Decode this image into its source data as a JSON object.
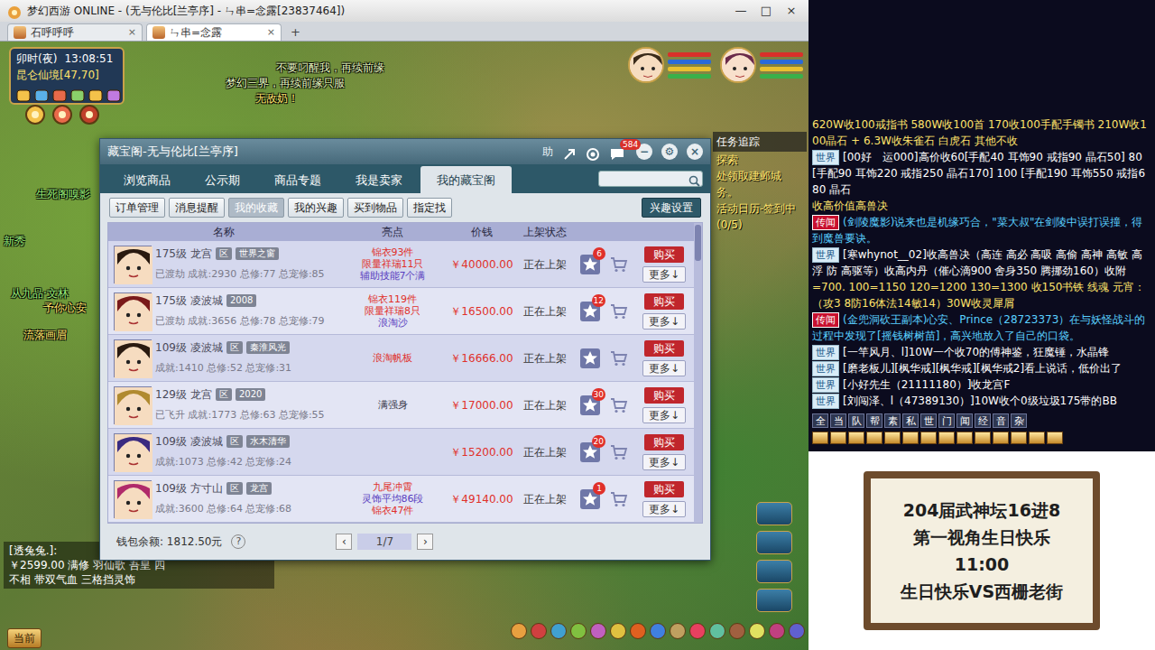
{
  "browser": {
    "title": "梦幻西游 ONLINE - (无与伦比[兰亭序] - ㄣ串=念露[23837464])",
    "controls": [
      "—",
      "□",
      "×"
    ],
    "tabs": [
      {
        "label": "石呼呼呼",
        "selected": false,
        "close": "×"
      },
      {
        "label": "ㄣ串=念露",
        "selected": true,
        "close": "×"
      }
    ],
    "new_tab": "+"
  },
  "hud": {
    "time": "卯时(夜)",
    "clock": "13:08:51",
    "location": "昆仑仙境[47,70]"
  },
  "scene_texts": [
    "不要叼醒我，再续前缘",
    "梦幻三界，再续前缘只服",
    "无敌奶！",
    "生死阁嗅影",
    "新秀",
    "从九品·文林",
    "予你心安",
    "流落画眉"
  ],
  "task": {
    "title": "任务追踪",
    "lines": [
      "探索",
      "处领取建邺城",
      "务。",
      "活动日历-签到中",
      "(0/5)"
    ]
  },
  "scene_chat": {
    "speaker": "[透兔兔.]:",
    "lines": [
      "￥2599.00  满修  羽仙歌  吾皇  四",
      "不相  带双气血  三格挡灵饰"
    ]
  },
  "bottom_button": "当前",
  "cbg": {
    "title": "藏宝阁-无与伦比[兰亭序]",
    "help": "助",
    "message_count": "584",
    "controls": [
      "−",
      "⚙",
      "×"
    ],
    "nav": [
      {
        "label": "浏览商品",
        "selected": false
      },
      {
        "label": "公示期",
        "selected": false
      },
      {
        "label": "商品专题",
        "selected": false
      },
      {
        "label": "我是卖家",
        "selected": false
      },
      {
        "label": "我的藏宝阁",
        "selected": true
      }
    ],
    "subnav": [
      {
        "label": "订单管理",
        "selected": false
      },
      {
        "label": "消息提醒",
        "selected": false
      },
      {
        "label": "我的收藏",
        "selected": true
      },
      {
        "label": "我的兴趣",
        "selected": false
      },
      {
        "label": "买到物品",
        "selected": false
      },
      {
        "label": "指定找",
        "selected": false
      }
    ],
    "interest_button": "兴趣设置",
    "columns": [
      "名称",
      "亮点",
      "价钱",
      "上架状态"
    ],
    "rows": [
      {
        "level": "175级",
        "school": "龙宫",
        "tags": [
          "区",
          "世界之窗"
        ],
        "info": "已渡劫 成就:2930 总修:77 总宠修:85",
        "highlights": [
          {
            "text": "锦衣93件",
            "color": "#e0302a"
          },
          {
            "text": "限量祥瑞11只",
            "color": "#e0302a"
          },
          {
            "text": "辅助技能7个满",
            "color": "#5a3fc0"
          }
        ],
        "price": "￥40000.00",
        "status": "正在上架",
        "favorites": "6",
        "buy": "购买",
        "more": "更多↓"
      },
      {
        "level": "175级",
        "school": "凌波城",
        "tags": [
          "2008"
        ],
        "info": "已渡劫 成就:3656 总修:78 总宠修:79",
        "highlights": [
          {
            "text": "锦衣119件",
            "color": "#e0302a"
          },
          {
            "text": "限量祥瑞8只",
            "color": "#e0302a"
          },
          {
            "text": "浪淘沙",
            "color": "#5a3fc0"
          }
        ],
        "price": "￥16500.00",
        "status": "正在上架",
        "favorites": "12",
        "buy": "购买",
        "more": "更多↓"
      },
      {
        "level": "109级",
        "school": "凌波城",
        "tags": [
          "区",
          "秦淮风光"
        ],
        "info": "成就:1410 总修:52 总宠修:31",
        "highlights": [
          {
            "text": "浪淘帆板",
            "color": "#e0302a"
          }
        ],
        "price": "￥16666.00",
        "status": "正在上架",
        "buy": "购买",
        "more": "更多↓"
      },
      {
        "level": "129级",
        "school": "龙宫",
        "tags": [
          "区",
          "2020"
        ],
        "info": "已飞升 成就:1773 总修:63 总宠修:55",
        "highlights": [
          {
            "text": "满强身",
            "color": "#333344"
          }
        ],
        "price": "￥17000.00",
        "status": "正在上架",
        "favorites": "30",
        "buy": "购买",
        "more": "更多↓"
      },
      {
        "level": "109级",
        "school": "凌波城",
        "tags": [
          "区",
          "水木清华"
        ],
        "info": "成就:1073 总修:42 总宠修:24",
        "highlights": [],
        "price": "￥15200.00",
        "status": "正在上架",
        "favorites": "20",
        "buy": "购买",
        "more": "更多↓"
      },
      {
        "level": "109级",
        "school": "方寸山",
        "tags": [
          "区",
          "龙宫"
        ],
        "info": "成就:3600 总修:64 总宠修:68",
        "highlights": [
          {
            "text": "九尾冲霄",
            "color": "#e0302a"
          },
          {
            "text": "灵饰平均86段",
            "color": "#5a3fc0"
          },
          {
            "text": "锦衣47件",
            "color": "#e0302a"
          }
        ],
        "price": "￥49140.00",
        "status": "正在上架",
        "favorites": "1",
        "buy": "购买",
        "more": "更多↓"
      }
    ],
    "wallet": "钱包余额: 1812.50元",
    "help_q": "?",
    "prev": "‹",
    "page": "1/7",
    "next": "›"
  },
  "chat": {
    "lines": [
      {
        "kind": "plain",
        "channel": "",
        "text": "620W收100戒指书 580W收100首 170收100手配手镯书 210W收100晶石 + 6.3W收朱雀石 白虎石 其他不收"
      },
      {
        "kind": "world",
        "channel": "世界",
        "text": "[00好ゞ运000]高价收60[手配40 耳饰90 戒指90 晶石50]  80[手配90 耳饰220 戒指250 晶石170]  100 [手配190 耳饰550 戒指680 晶石"
      },
      {
        "kind": "plain",
        "channel": "",
        "text": "收高价值高兽决"
      },
      {
        "kind": "rumor",
        "channel": "传闻",
        "text": "(剑陵魔影)说来也是机缘巧合，\"菜大叔\"在剑陵中误打误撞，得到魔兽要诀。"
      },
      {
        "kind": "world",
        "channel": "世界",
        "text": "[寒whynot__02]收高兽决（高连 高必 高吸 高偷 高神 高敏 高浮 防 高驱等）收高内丹（催心滴900 舍身350 腾挪劲160）收附"
      },
      {
        "kind": "plain",
        "channel": "",
        "text": "=700. 100=1150 120=1200 130=1300 收150书铁 线魂 元宵：（攻3 8防16体法14敏14）30W收灵犀屑"
      },
      {
        "kind": "rumor",
        "channel": "传闻",
        "text": "(金兜洞砍王副本)心安、Prince（28723373）在与妖怪战斗的过程中发现了[摇钱树树苗]，高兴地放入了自己的口袋。"
      },
      {
        "kind": "world",
        "channel": "世界",
        "text": "[一竿风月、l]10W一个收70的傅神鉴，狂魔锤，水晶锋"
      },
      {
        "kind": "world",
        "channel": "世界",
        "text": "[磨老板儿][枫华戒][枫华戒][枫华戒2]看上说话，低价出了"
      },
      {
        "kind": "world",
        "channel": "世界",
        "text": "[小好先生（21111180）]收龙宫F"
      },
      {
        "kind": "world",
        "channel": "世界",
        "text": "[刘闯泽、l（47389130）]10W收个0级垃圾175带的BB"
      }
    ],
    "filters": [
      "全",
      "当",
      "队",
      "帮",
      "素",
      "私",
      "世",
      "门",
      "闻",
      "经",
      "音",
      "杂"
    ]
  },
  "board": {
    "lines": [
      "204届武神坛16进8",
      "第一视角生日快乐",
      "11:00",
      "生日快乐VS西栅老街"
    ]
  }
}
